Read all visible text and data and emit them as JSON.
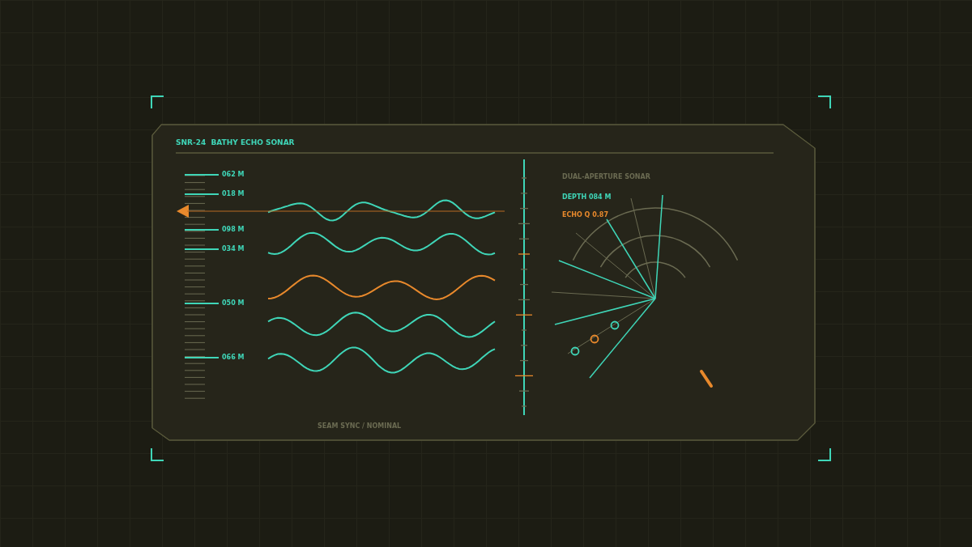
{
  "title": "SNR-24  BATHY ECHO SONAR",
  "depth_marks": [
    {
      "label": "062 M"
    },
    {
      "label": "018 M"
    },
    {
      "label": "098 M"
    },
    {
      "label": "034 M"
    },
    {
      "label": "050 M"
    },
    {
      "label": "066 M"
    }
  ],
  "status": "SEAM SYNC / NOMINAL",
  "readout": {
    "caption": "DUAL-APERTURE SONAR",
    "depth": "DEPTH 084 M",
    "echo": "ECHO Q 0.87"
  }
}
